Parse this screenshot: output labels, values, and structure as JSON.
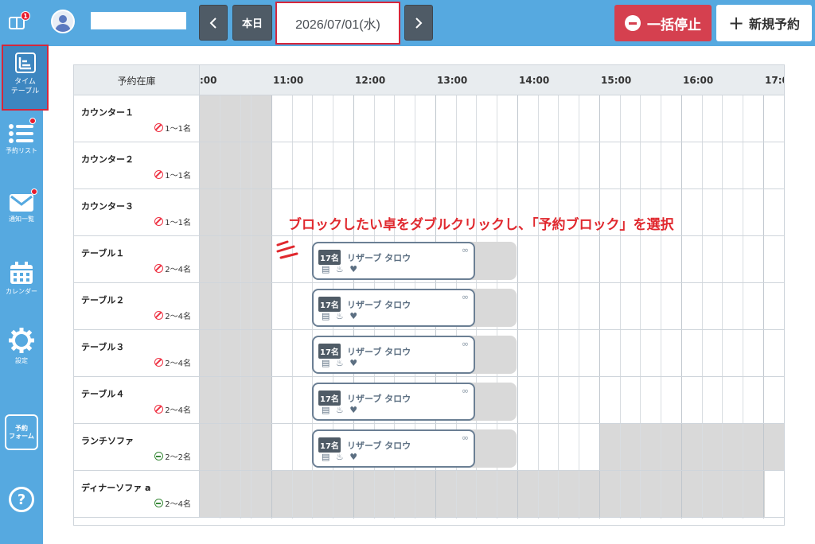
{
  "header": {
    "notification_badge": "1",
    "today_label": "本日",
    "prev_label": "<",
    "next_label": ">",
    "date": "2026/07/01(水)",
    "stop_label": "一括停止",
    "new_label": "新規予約"
  },
  "sidebar": {
    "timetable": "タイム\nテーブル",
    "list": "予約リスト",
    "notice": "通知一覧",
    "calendar": "カレンダー",
    "settings": "設定",
    "form": "予約\nフォーム",
    "help": "?"
  },
  "table": {
    "column_title": "予約在庫",
    "hours": [
      ":00",
      "11:00",
      "12:00",
      "13:00",
      "14:00",
      "15:00",
      "16:00",
      "17:0"
    ],
    "rows": [
      {
        "name": "カウンター１",
        "capacity": "1〜1名",
        "smoking": "no"
      },
      {
        "name": "カウンター２",
        "capacity": "1〜1名",
        "smoking": "no"
      },
      {
        "name": "カウンター３",
        "capacity": "1〜1名",
        "smoking": "no"
      },
      {
        "name": "テーブル１",
        "capacity": "2〜4名",
        "smoking": "no"
      },
      {
        "name": "テーブル２",
        "capacity": "2〜4名",
        "smoking": "no"
      },
      {
        "name": "テーブル３",
        "capacity": "2〜4名",
        "smoking": "no"
      },
      {
        "name": "テーブル４",
        "capacity": "2〜4名",
        "smoking": "no"
      },
      {
        "name": "ランチソファ",
        "capacity": "2〜2名",
        "smoking": "ok"
      },
      {
        "name": "ディナーソファ a",
        "capacity": "2〜4名",
        "smoking": "ok"
      }
    ]
  },
  "reservation": {
    "count": "17名",
    "guest": "リザーブ タロウ"
  },
  "annotation": "ブロックしたい卓をダブルクリックし、「予約ブロック」を選択",
  "colors": {
    "header_bg": "#56a9e0",
    "stop_btn": "#d5404f",
    "highlight": "#d6263b",
    "annotation": "#e0282e"
  }
}
